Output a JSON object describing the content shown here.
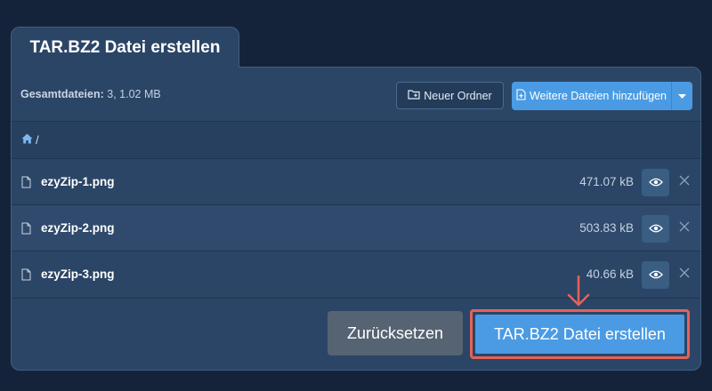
{
  "tab": {
    "title": "TAR.BZ2 Datei erstellen"
  },
  "toolbar": {
    "summary_label": "Gesamtdateien:",
    "summary_value": " 3, 1.02 MB",
    "new_folder_label": "Neuer Ordner",
    "add_files_label": "Weitere Dateien hinzufügen"
  },
  "breadcrumb": {
    "path": "/"
  },
  "files": [
    {
      "name": "ezyZip-1.png",
      "size": "471.07 kB"
    },
    {
      "name": "ezyZip-2.png",
      "size": "503.83 kB"
    },
    {
      "name": "ezyZip-3.png",
      "size": "40.66 kB"
    }
  ],
  "footer": {
    "reset_label": "Zurücksetzen",
    "create_label": "TAR.BZ2 Datei erstellen"
  },
  "colors": {
    "background": "#15233a",
    "panel": "#2b4566",
    "primary": "#4a9be4",
    "highlight": "#e5625a",
    "reset": "#566372"
  },
  "icons": [
    "folder-plus-icon",
    "file-plus-icon",
    "caret-down-icon",
    "home-icon",
    "file-icon",
    "eye-icon",
    "close-icon",
    "arrow-down-icon"
  ]
}
